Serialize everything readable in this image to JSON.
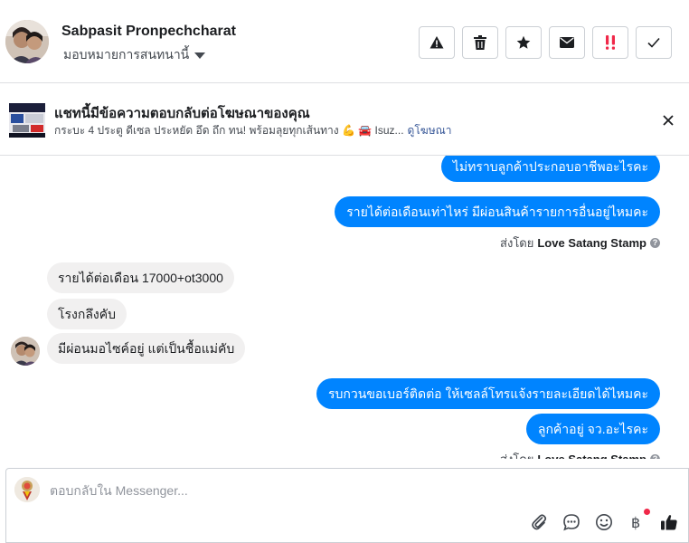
{
  "header": {
    "contact_name": "Sabpasit Pronpechcharat",
    "assign_label": "มอบหมายการสนทนานี้",
    "actions": [
      {
        "icon": "warning-icon",
        "color": "#1c1e21"
      },
      {
        "icon": "trash-icon",
        "color": "#1c1e21"
      },
      {
        "icon": "star-icon",
        "color": "#1c1e21"
      },
      {
        "icon": "envelope-icon",
        "color": "#1c1e21"
      },
      {
        "icon": "exclamation-icon",
        "color": "#f02849"
      },
      {
        "icon": "check-icon",
        "color": "#1c1e21"
      }
    ]
  },
  "ad": {
    "title": "แชทนี้มีข้อความตอบกลับต่อโฆษณาของคุณ",
    "text": "กระบะ 4 ประตู ดีเซล ประหยัด อึด ถึก ทน! พร้อมลุยทุกเส้นทาง 💪 🚘 Isuz...",
    "link": "ดูโฆษณา"
  },
  "messages": {
    "out_1": "ไม่ทราบลูกค้าประกอบอาชีพอะไรคะ",
    "out_2": "รายได้ต่อเดือนเท่าไหร่ มีผ่อนสินค้ารายการอื่นอยู่ไหมคะ",
    "in_1": "รายได้ต่อเดือน 17000+ot3000",
    "in_2": "โรงกลึงคับ",
    "in_3": "มีผ่อนมอไซค์อยู่ แต่เป็นชื้อแม่คับ",
    "out_3": "รบกวนขอเบอร์ติดต่อ ให้เซลล์โทรแจ้งรายละเอียดได้ไหมคะ",
    "out_4": "ลูกค้าอยู่ จว.อะไรคะ"
  },
  "sent_by": {
    "prefix": "ส่งโดย",
    "sender": "Love Satang Stamp"
  },
  "composer": {
    "placeholder": "ตอบกลับใน Messenger...",
    "tools": [
      "attach-icon",
      "saved-replies-icon",
      "emoji-icon",
      "payment-icon",
      "like-icon"
    ]
  },
  "colors": {
    "accent": "#0084ff",
    "link": "#385898",
    "incoming_bubble": "#f1f0f0",
    "notification_dot": "#f02849"
  }
}
